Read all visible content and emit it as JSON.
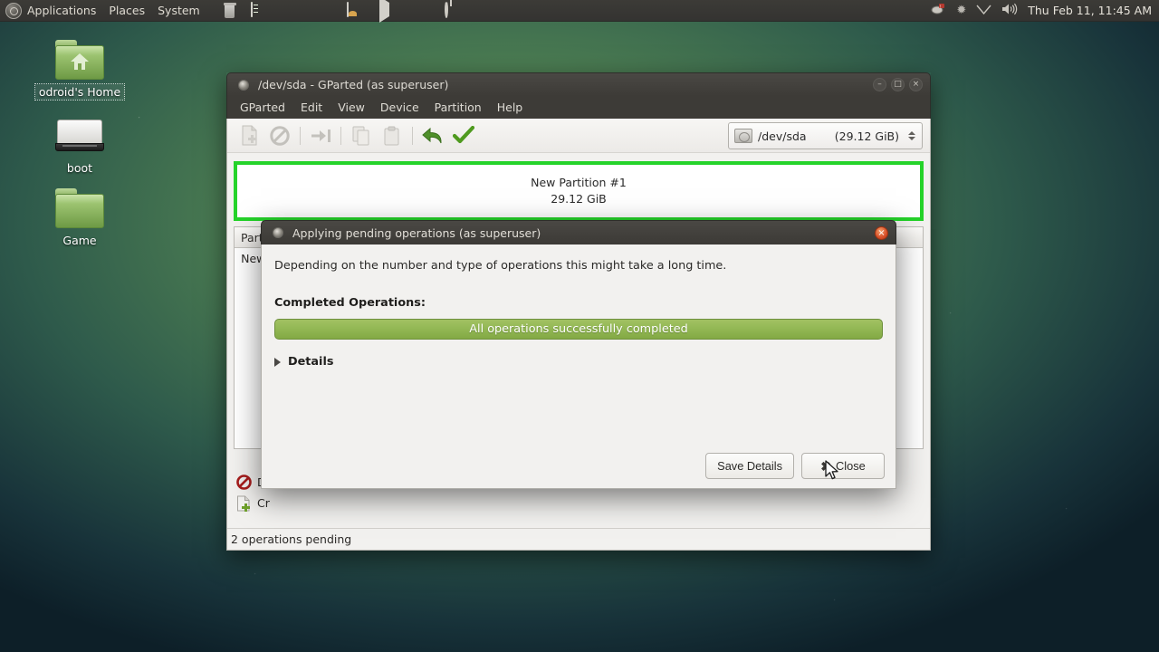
{
  "panel": {
    "logo_icon": "ubuntu-logo-icon",
    "menus": [
      "Applications",
      "Places",
      "System"
    ],
    "launchers": [
      {
        "name": "trash-icon"
      },
      {
        "name": "terminal-icon"
      }
    ],
    "indicators": [
      {
        "name": "screenshot-icon"
      },
      {
        "name": "play-icon"
      },
      {
        "name": "stop-icon"
      },
      {
        "name": "power-icon"
      }
    ],
    "tray": [
      {
        "name": "network-icon"
      },
      {
        "name": "bluetooth-icon"
      },
      {
        "name": "wifi-icon"
      },
      {
        "name": "volume-icon"
      }
    ],
    "clock": "Thu Feb 11, 11:45 AM"
  },
  "desktop": {
    "icons": [
      {
        "label": "odroid's Home",
        "icon": "home-folder-icon",
        "selected": true
      },
      {
        "label": "boot",
        "icon": "drive-icon",
        "selected": false
      },
      {
        "label": "Game",
        "icon": "folder-icon",
        "selected": false
      }
    ]
  },
  "gparted": {
    "title": "/dev/sda - GParted (as superuser)",
    "window_buttons": {
      "minimize": "–",
      "maximize": "□",
      "close": "×"
    },
    "menu": [
      "GParted",
      "Edit",
      "View",
      "Device",
      "Partition",
      "Help"
    ],
    "toolbar": [
      {
        "name": "new-partition-button",
        "enabled": false
      },
      {
        "name": "delete-partition-button",
        "enabled": false
      },
      {
        "name": "resize-move-button",
        "enabled": false
      },
      {
        "name": "copy-button",
        "enabled": false
      },
      {
        "name": "paste-button",
        "enabled": false
      },
      {
        "name": "undo-button",
        "enabled": true
      },
      {
        "name": "apply-button",
        "enabled": true
      }
    ],
    "device_selector": {
      "icon": "hard-disk-icon",
      "device": "/dev/sda",
      "size": "(29.12 GiB)"
    },
    "disk_map": {
      "partition_name": "New Partition #1",
      "partition_size": "29.12 GiB",
      "border_color": "#25d32a"
    },
    "partition_table": {
      "headers": [
        "Partition"
      ],
      "rows": [
        {
          "partition": "New Partition #1"
        }
      ]
    },
    "operations": [
      {
        "icon": "delete-operation-icon",
        "label": "D"
      },
      {
        "icon": "create-operation-icon",
        "label": "Cr"
      }
    ],
    "statusbar": "2 operations pending"
  },
  "dialog": {
    "title": "Applying pending operations (as superuser)",
    "close_label": "×",
    "description": "Depending on the number and type of operations this might take a long time.",
    "completed_label": "Completed Operations:",
    "progress": {
      "text": "All operations successfully completed",
      "percent": 100,
      "color": "#93b855"
    },
    "details_label": "Details",
    "buttons": {
      "save_details": "Save Details",
      "close": "Close"
    }
  }
}
